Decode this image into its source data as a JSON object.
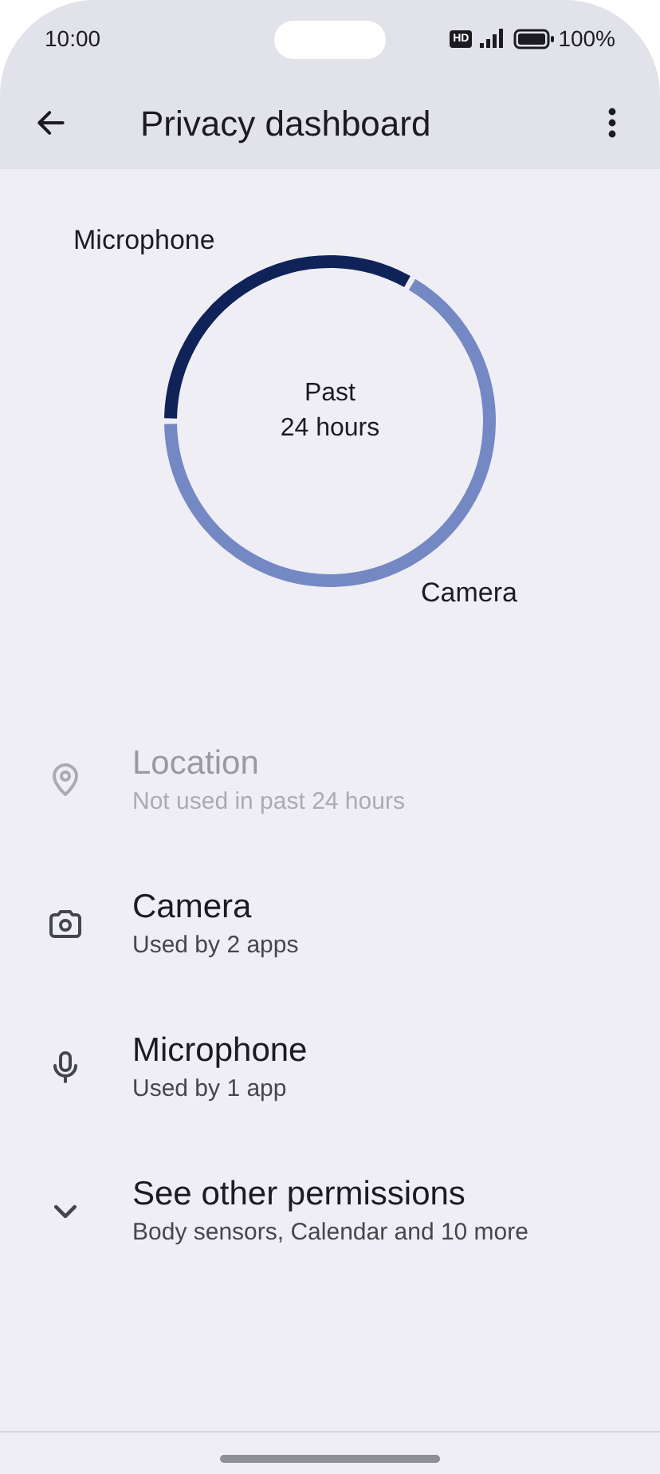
{
  "status_bar": {
    "time": "10:00",
    "hd_badge": "HD",
    "battery": "100%"
  },
  "app_bar": {
    "title": "Privacy dashboard"
  },
  "usage_chart": {
    "center_text": [
      "Past",
      "24 hours"
    ],
    "segments": [
      {
        "label": "Microphone",
        "color": "#0f2358"
      },
      {
        "label": "Camera",
        "color": "#7488c4"
      }
    ]
  },
  "permissions": [
    {
      "kind": "location",
      "title": "Location",
      "subtitle": "Not used in past 24 hours",
      "disabled": true
    },
    {
      "kind": "camera",
      "title": "Camera",
      "subtitle": "Used by 2 apps",
      "disabled": false
    },
    {
      "kind": "microphone",
      "title": "Microphone",
      "subtitle": "Used by 1 app",
      "disabled": false
    },
    {
      "kind": "expand",
      "title": "See other permissions",
      "subtitle": "Body sensors, Calendar and 10 more",
      "disabled": false
    }
  ]
}
